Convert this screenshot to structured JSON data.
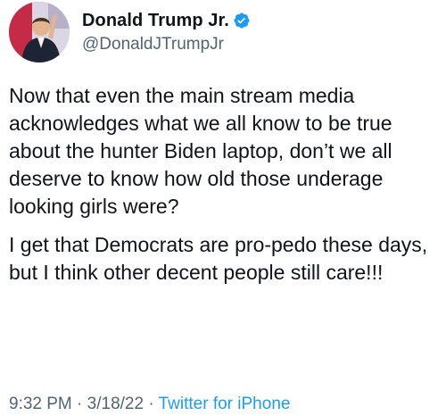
{
  "tweet": {
    "author": {
      "display_name": "Donald Trump Jr.",
      "handle": "@DonaldJTrumpJr",
      "verified": true
    },
    "paragraphs": [
      "Now that even the main stream media acknowledges what we all know to be true about the hunter Biden laptop, don’t we all deserve to know how old those underage looking girls were?",
      "I get that Democrats are pro-pedo these days, but I think other decent people still care!!!"
    ],
    "time": "9:32 PM",
    "separator": " · ",
    "date": "3/18/22",
    "source": "Twitter for iPhone"
  },
  "colors": {
    "text": "#0f1419",
    "secondary": "#536471",
    "accent": "#1d9bf0"
  },
  "icons": {
    "verified": "verified-badge-icon"
  }
}
